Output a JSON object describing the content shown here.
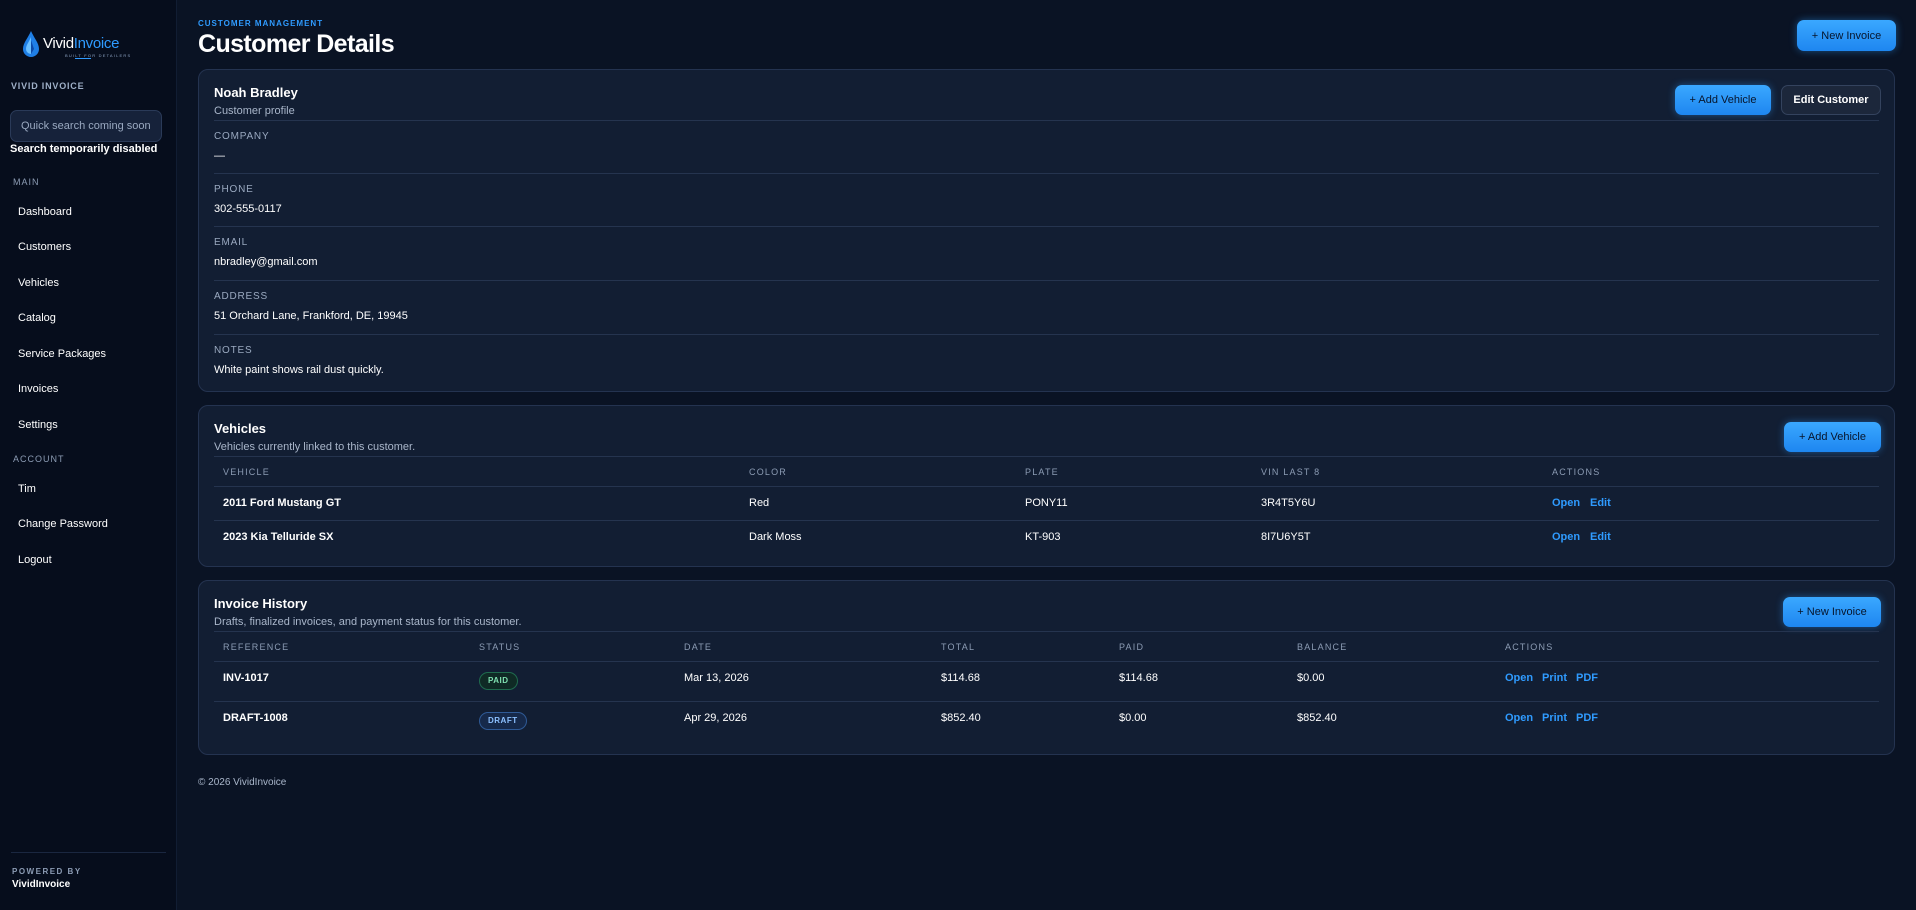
{
  "brand": {
    "logo_part1": "Vivid",
    "logo_part2": "Invoice",
    "tagline": "BUILT FOR DETAILERS",
    "sidebar_label": "VIVID INVOICE",
    "accent": "#2f9bff"
  },
  "search": {
    "placeholder": "Quick search coming soon",
    "note": "Search temporarily disabled"
  },
  "nav": {
    "main_label": "MAIN",
    "main_items": [
      "Dashboard",
      "Customers",
      "Vehicles",
      "Catalog",
      "Service Packages",
      "Invoices",
      "Settings"
    ],
    "account_label": "ACCOUNT",
    "account_items": [
      "Tim",
      "Change Password",
      "Logout"
    ]
  },
  "powered": {
    "label": "POWERED BY",
    "name": "VividInvoice"
  },
  "header": {
    "eyebrow": "CUSTOMER MANAGEMENT",
    "title": "Customer Details",
    "new_invoice_label": "+ New Invoice"
  },
  "profile": {
    "name": "Noah Bradley",
    "subtitle": "Customer profile",
    "add_vehicle_label": "+ Add Vehicle",
    "edit_label": "Edit Customer",
    "fields": [
      {
        "label": "COMPANY",
        "value": "—"
      },
      {
        "label": "PHONE",
        "value": "302-555-0117"
      },
      {
        "label": "EMAIL",
        "value": "nbradley@gmail.com"
      },
      {
        "label": "ADDRESS",
        "value": "51 Orchard Lane, Frankford, DE, 19945"
      },
      {
        "label": "NOTES",
        "value": "White paint shows rail dust quickly."
      }
    ]
  },
  "vehicles": {
    "title": "Vehicles",
    "subtitle": "Vehicles currently linked to this customer.",
    "add_label": "+ Add Vehicle",
    "columns": [
      "VEHICLE",
      "COLOR",
      "PLATE",
      "VIN LAST 8",
      "ACTIONS"
    ],
    "rows": [
      {
        "vehicle": "2011 Ford Mustang GT",
        "color": "Red",
        "plate": "PONY11",
        "vin": "3R4T5Y6U",
        "open": "Open",
        "edit": "Edit"
      },
      {
        "vehicle": "2023 Kia Telluride SX",
        "color": "Dark Moss",
        "plate": "KT-903",
        "vin": "8I7U6Y5T",
        "open": "Open",
        "edit": "Edit"
      }
    ]
  },
  "invoices": {
    "title": "Invoice History",
    "subtitle": "Drafts, finalized invoices, and payment status for this customer.",
    "new_label": "+ New Invoice",
    "columns": [
      "REFERENCE",
      "STATUS",
      "DATE",
      "TOTAL",
      "PAID",
      "BALANCE",
      "ACTIONS"
    ],
    "rows": [
      {
        "ref": "INV-1017",
        "status": "PAID",
        "date": "Mar 13, 2026",
        "total": "$114.68",
        "paid": "$114.68",
        "balance": "$0.00",
        "open": "Open",
        "print": "Print",
        "pdf": "PDF"
      },
      {
        "ref": "DRAFT-1008",
        "status": "DRAFT",
        "date": "Apr 29, 2026",
        "total": "$852.40",
        "paid": "$0.00",
        "balance": "$852.40",
        "open": "Open",
        "print": "Print",
        "pdf": "PDF"
      }
    ]
  },
  "footer": "© 2026 VividInvoice"
}
